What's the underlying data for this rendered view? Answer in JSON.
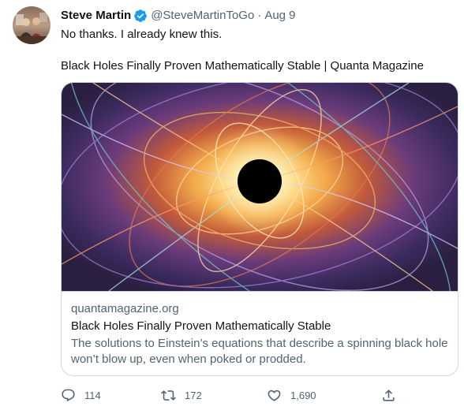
{
  "tweet": {
    "author": {
      "display_name": "Steve Martin",
      "handle": "@SteveMartinToGo",
      "verified": true
    },
    "separator": "·",
    "date": "Aug 9",
    "text_lines": [
      "No thanks. I already knew this.",
      "Black Holes Finally Proven Mathematically Stable | Quanta Magazine"
    ],
    "card": {
      "domain": "quantamagazine.org",
      "title": "Black Holes Finally Proven Mathematically Stable",
      "description": "The solutions to Einstein’s equations that describe a spinning black hole won’t blow up, even when poked or prodded."
    },
    "actions": {
      "reply_count": "114",
      "retweet_count": "172",
      "like_count": "1,690"
    }
  },
  "colors": {
    "text_primary": "#0f1419",
    "text_secondary": "#536471",
    "verified_blue": "#1d9bf0",
    "border": "#cfd9de"
  },
  "icons": [
    "verified-badge-icon",
    "reply-icon",
    "retweet-icon",
    "like-icon",
    "share-icon"
  ]
}
